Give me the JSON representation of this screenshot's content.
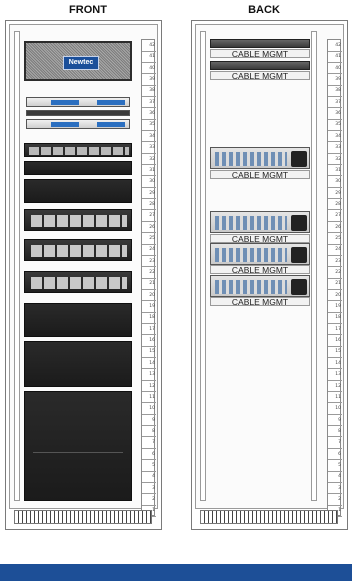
{
  "front": {
    "title": "FRONT",
    "logo_text": "Newtec"
  },
  "back": {
    "title": "BACK",
    "cable_label": "CABLE MGMT"
  },
  "ruler": [
    "42",
    "41",
    "40",
    "39",
    "38",
    "37",
    "36",
    "35",
    "34",
    "33",
    "32",
    "31",
    "30",
    "29",
    "28",
    "27",
    "26",
    "25",
    "24",
    "23",
    "22",
    "21",
    "20",
    "19",
    "18",
    "17",
    "16",
    "15",
    "14",
    "13",
    "12",
    "11",
    "10",
    "9",
    "8",
    "7",
    "6",
    "5",
    "4",
    "3",
    "2",
    "1"
  ],
  "colors": {
    "footer": "#1d4f97",
    "logo_plate": "#1b4f9a"
  }
}
